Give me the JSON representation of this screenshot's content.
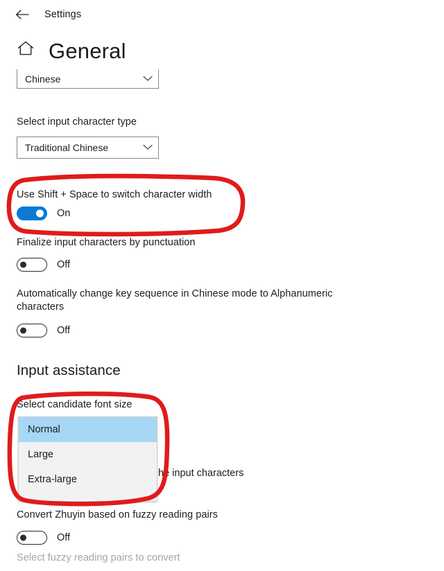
{
  "window": {
    "titlebar_label": "Settings",
    "back_icon": "back-arrow-icon"
  },
  "header": {
    "home_icon": "home-icon",
    "title": "General"
  },
  "settings": {
    "language_combo": {
      "value": "Chinese",
      "chevron": "chevron-down-icon"
    },
    "input_character_type": {
      "label": "Select input character type",
      "value": "Traditional Chinese",
      "chevron": "chevron-down-icon"
    },
    "shift_space_width": {
      "label": "Use Shift + Space to switch character width",
      "state": "On",
      "enabled": true
    },
    "finalize_punctuation": {
      "label": "Finalize input characters by punctuation",
      "state": "Off",
      "enabled": false
    },
    "auto_change_key_sequence": {
      "label": "Automatically change key sequence in Chinese mode to Alphanumeric characters",
      "state": "Off",
      "enabled": false
    }
  },
  "input_assistance": {
    "heading": "Input assistance",
    "candidate_font_size": {
      "label": "Select candidate font size",
      "selected": "Normal",
      "options": [
        {
          "label": "Normal",
          "selected": true
        },
        {
          "label": "Large",
          "selected": false
        },
        {
          "label": "Extra-large",
          "selected": false
        }
      ]
    },
    "obscured_setting_text": "he input characters",
    "convert_zhuyin": {
      "label": "Convert Zhuyin based on fuzzy reading pairs",
      "state": "Off",
      "enabled": false
    },
    "fuzzy_pairs_link": "Select fuzzy reading pairs to convert"
  },
  "annotations": {
    "color": "#e01b1b",
    "box_1_target": "shift-space-setting",
    "box_2_target": "candidate-font-size-dropdown"
  }
}
